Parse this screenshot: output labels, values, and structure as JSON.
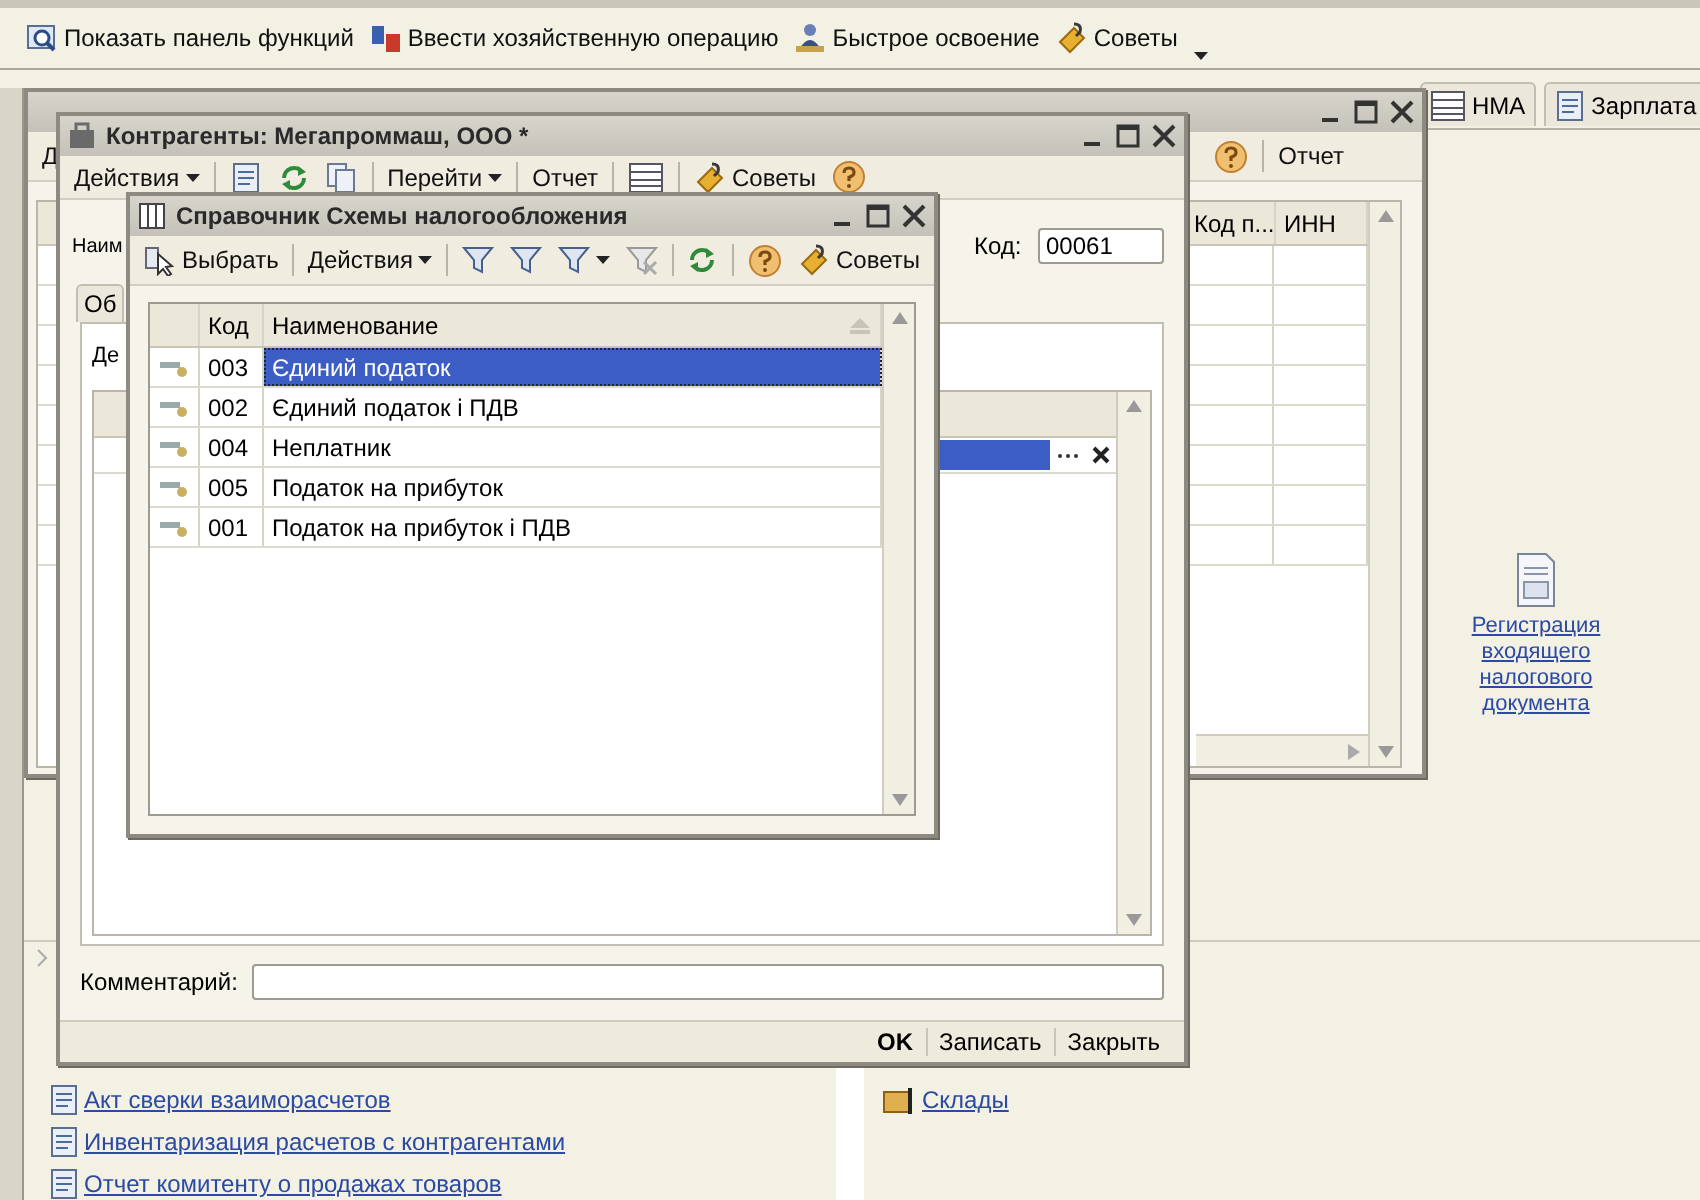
{
  "top_toolbar": [
    {
      "kind": "button",
      "label": "Показать панель функций"
    },
    {
      "kind": "button",
      "label": "Ввести хозяйственную операцию"
    },
    {
      "kind": "button",
      "label": "Быстрое освоение"
    },
    {
      "kind": "tips",
      "label": "Советы"
    },
    {
      "kind": "more"
    }
  ],
  "tabs": [
    {
      "label": "НМА",
      "selected": false
    },
    {
      "label": "Зарплата",
      "selected": false
    }
  ],
  "list_window": {
    "toolbar": [
      {
        "kind": "text",
        "label": "Д"
      }
    ],
    "toolbar_right": [
      {
        "kind": "help"
      },
      {
        "kind": "sep"
      },
      {
        "kind": "text",
        "label": "Отчет"
      }
    ],
    "columns": [
      "Код п...",
      "ИНН"
    ]
  },
  "form_window": {
    "title": "Контрагенты: Мегапроммаш, ООО *",
    "toolbar": [
      {
        "kind": "menu",
        "label": "Действия"
      },
      {
        "kind": "sep"
      },
      {
        "kind": "icon"
      },
      {
        "kind": "icon"
      },
      {
        "kind": "icon"
      },
      {
        "kind": "sep"
      },
      {
        "kind": "menu",
        "label": "Перейти"
      },
      {
        "kind": "sep"
      },
      {
        "kind": "text",
        "label": "Отчет"
      },
      {
        "kind": "sep"
      },
      {
        "kind": "icon"
      },
      {
        "kind": "sep"
      },
      {
        "kind": "tips",
        "label": "Советы"
      },
      {
        "kind": "help"
      }
    ],
    "name_label": "Наим",
    "code_label": "Код:",
    "code_value": "00061",
    "tab_label": "Об",
    "section_label": "Де",
    "comment_label": "Комментарий:",
    "buttons": [
      {
        "label": "OK",
        "default": true
      },
      {
        "label": "Записать",
        "default": false
      },
      {
        "label": "Закрыть",
        "default": false
      }
    ]
  },
  "dialog": {
    "title": "Справочник Схемы налогообложения",
    "toolbar": [
      {
        "kind": "icontext",
        "label": "Выбрать"
      },
      {
        "kind": "sep"
      },
      {
        "kind": "menu",
        "label": "Действия"
      },
      {
        "kind": "sep"
      },
      {
        "kind": "icon"
      },
      {
        "kind": "icon"
      },
      {
        "kind": "iconmenu"
      },
      {
        "kind": "icon"
      },
      {
        "kind": "sep"
      },
      {
        "kind": "icon"
      },
      {
        "kind": "sep"
      },
      {
        "kind": "help"
      },
      {
        "kind": "tips",
        "label": "Советы"
      }
    ],
    "columns": [
      "Код",
      "Наименование"
    ],
    "rows": [
      {
        "code": "003",
        "name": "Єдиний податок",
        "selected": true
      },
      {
        "code": "002",
        "name": "Єдиний податок і ПДВ",
        "selected": false
      },
      {
        "code": "004",
        "name": "Неплатник",
        "selected": false
      },
      {
        "code": "005",
        "name": "Податок на прибуток",
        "selected": false
      },
      {
        "code": "001",
        "name": "Податок на прибуток і ПДВ",
        "selected": false
      }
    ]
  },
  "register_link": "Регистрация входящего налогового документа",
  "report_links": [
    "Акт сверки взаиморасчетов",
    "Инвентаризация расчетов с контрагентами",
    "Отчет комитенту о продажах товаров"
  ],
  "warehouse_link": "Склады"
}
